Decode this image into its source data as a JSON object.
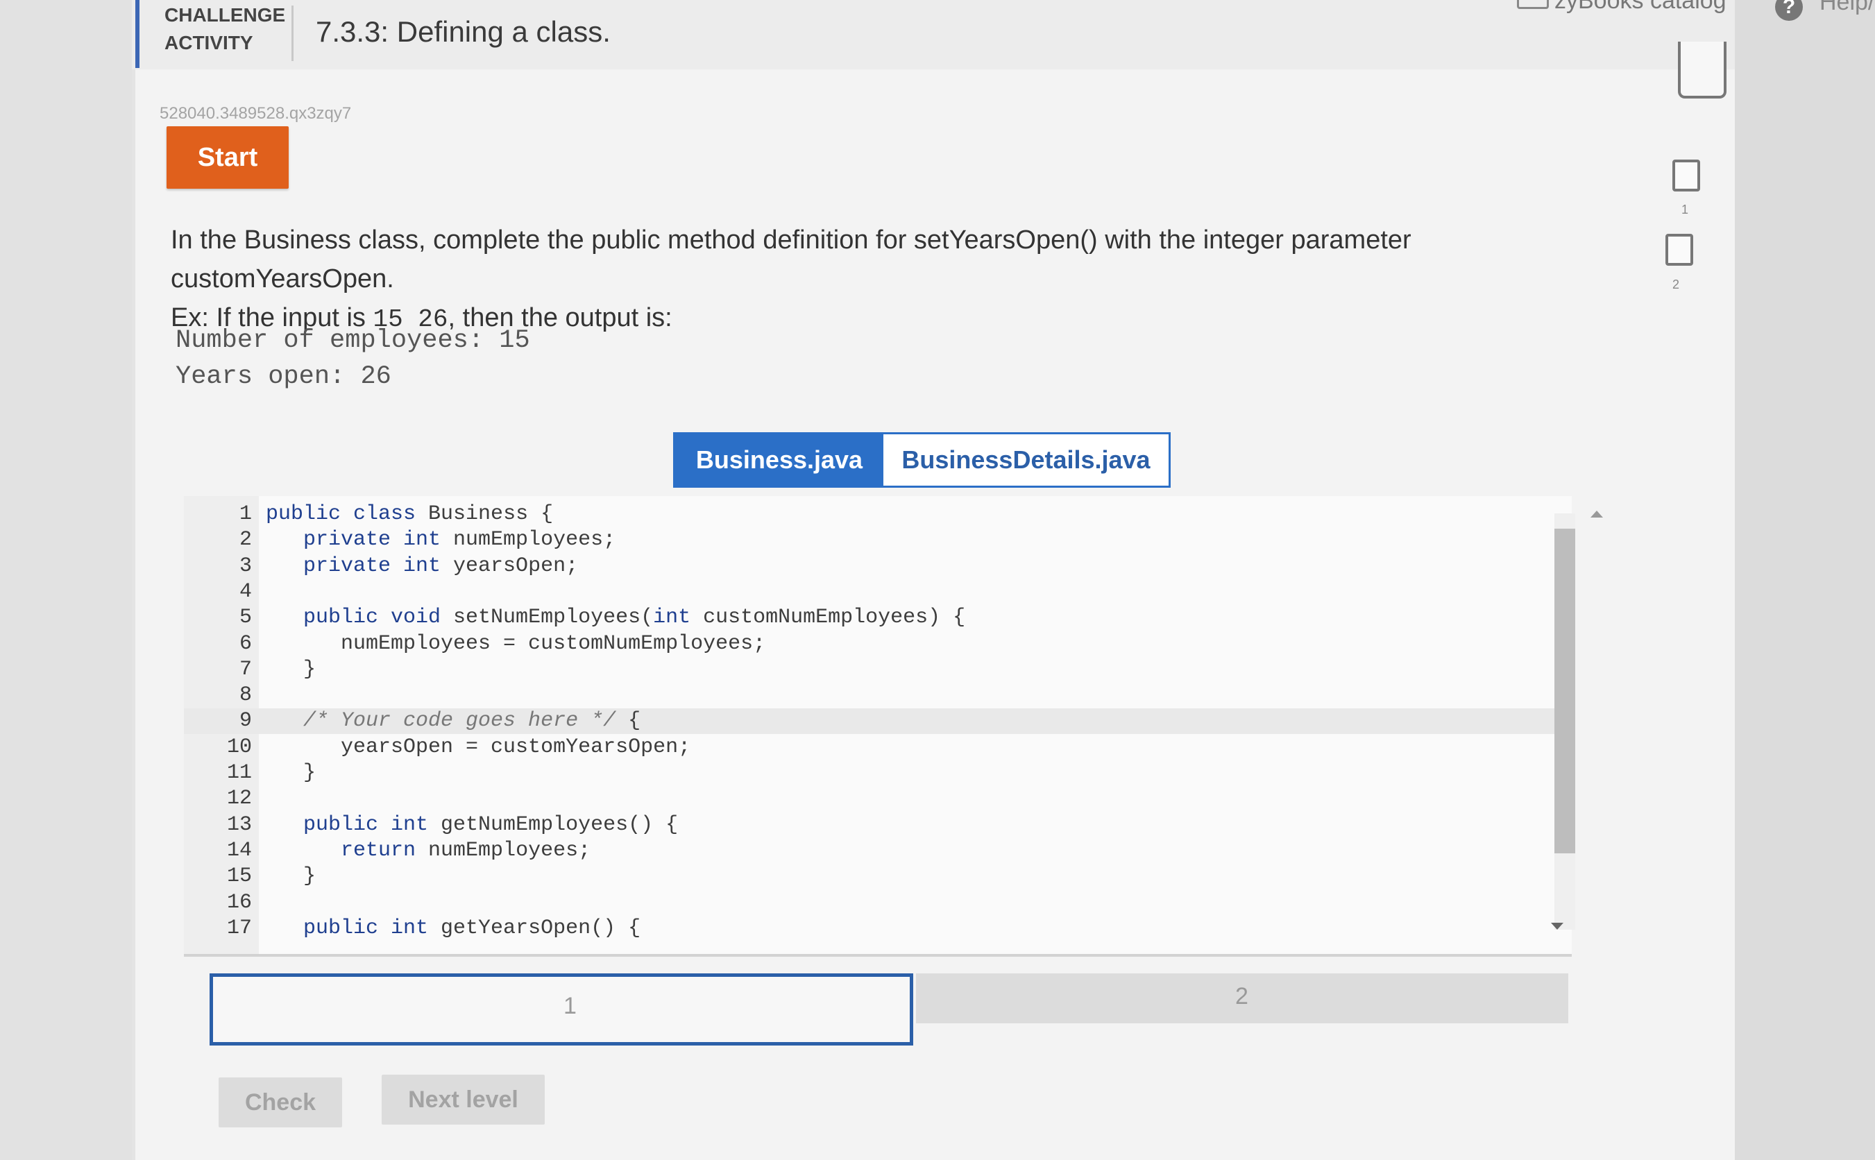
{
  "header": {
    "activity_label_line1": "CHALLENGE",
    "activity_label_line2": "ACTIVITY",
    "activity_title": "7.3.3: Defining a class.",
    "catalog_link": "zyBooks catalog",
    "help_icon_glyph": "?",
    "help_link": "Help/"
  },
  "activity": {
    "id": "528040.3489528.qx3zqy7",
    "start_label": "Start"
  },
  "instructions": {
    "line1": "In the Business class, complete the public method definition for setYearsOpen() with the integer parameter customYearsOpen.",
    "line2_prefix": "Ex: If the input is ",
    "line2_input": "15 26",
    "line2_suffix": ", then the output is:"
  },
  "expected_output": {
    "line1": "Number of employees: 15",
    "line2": "Years open: 26"
  },
  "levels": {
    "items": [
      "1",
      "2"
    ],
    "icon": "level-checkbox-icon"
  },
  "file_tabs": {
    "active": "Business.java",
    "inactive": "BusinessDetails.java"
  },
  "editor": {
    "lines": [
      {
        "n": "1",
        "parts": [
          {
            "t": "public class ",
            "c": "kw"
          },
          {
            "t": "Business {"
          }
        ]
      },
      {
        "n": "2",
        "parts": [
          {
            "t": "   private int ",
            "c": "kw"
          },
          {
            "t": "numEmployees;"
          }
        ]
      },
      {
        "n": "3",
        "parts": [
          {
            "t": "   private int ",
            "c": "kw"
          },
          {
            "t": "yearsOpen;"
          }
        ]
      },
      {
        "n": "4",
        "parts": [
          {
            "t": ""
          }
        ]
      },
      {
        "n": "5",
        "parts": [
          {
            "t": "   public void ",
            "c": "kw"
          },
          {
            "t": "setNumEmployees("
          },
          {
            "t": "int ",
            "c": "kw"
          },
          {
            "t": "customNumEmployees) {"
          }
        ]
      },
      {
        "n": "6",
        "parts": [
          {
            "t": "      numEmployees = customNumEmployees;"
          }
        ]
      },
      {
        "n": "7",
        "parts": [
          {
            "t": "   }"
          }
        ]
      },
      {
        "n": "8",
        "parts": [
          {
            "t": ""
          }
        ]
      },
      {
        "n": "9",
        "parts": [
          {
            "t": "   /* Your code goes here */",
            "c": "cm"
          },
          {
            "t": " {"
          }
        ],
        "active": true
      },
      {
        "n": "10",
        "parts": [
          {
            "t": "      yearsOpen = customYearsOpen;"
          }
        ]
      },
      {
        "n": "11",
        "parts": [
          {
            "t": "   }"
          }
        ]
      },
      {
        "n": "12",
        "parts": [
          {
            "t": ""
          }
        ]
      },
      {
        "n": "13",
        "parts": [
          {
            "t": "   public int ",
            "c": "kw"
          },
          {
            "t": "getNumEmployees() {"
          }
        ]
      },
      {
        "n": "14",
        "parts": [
          {
            "t": "      return ",
            "c": "kw"
          },
          {
            "t": "numEmployees;"
          }
        ]
      },
      {
        "n": "15",
        "parts": [
          {
            "t": "   }"
          }
        ]
      },
      {
        "n": "16",
        "parts": [
          {
            "t": ""
          }
        ]
      },
      {
        "n": "17",
        "parts": [
          {
            "t": "   public int ",
            "c": "kw"
          },
          {
            "t": "getYearsOpen() {"
          }
        ]
      }
    ]
  },
  "progress": {
    "segments": [
      "1",
      "2"
    ],
    "current": "1"
  },
  "buttons": {
    "check": "Check",
    "next_level": "Next level"
  },
  "colors": {
    "start_button": "#e0601c",
    "tab_active": "#2b6fc7",
    "accent_border": "#2b5fa8"
  }
}
